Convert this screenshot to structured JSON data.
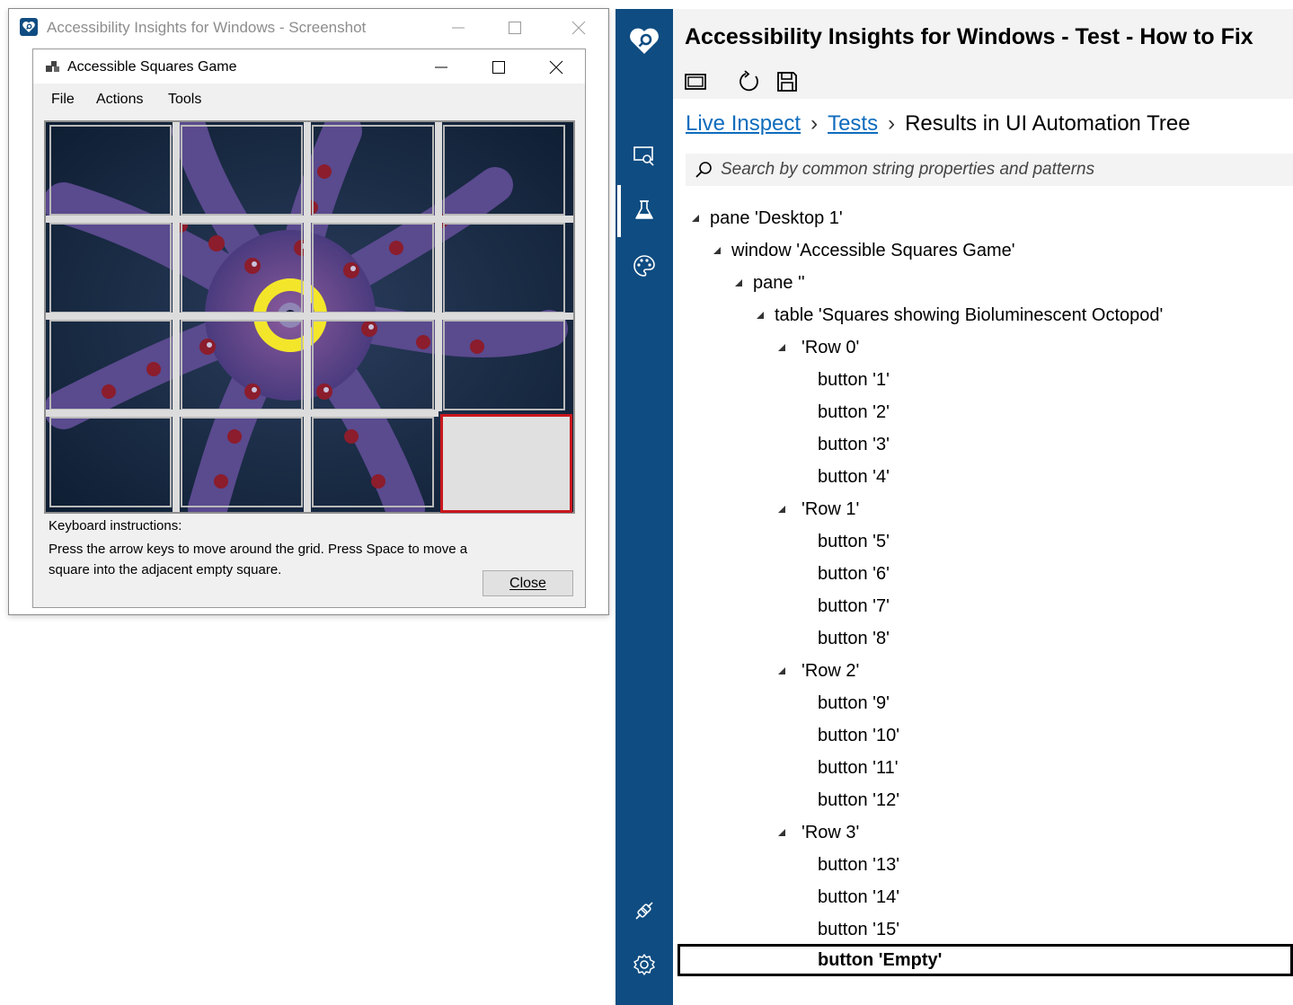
{
  "screenshot_window": {
    "title": "Accessibility Insights for Windows - Screenshot",
    "game": {
      "title": "Accessible Squares Game",
      "menu": [
        "File",
        "Actions",
        "Tools"
      ],
      "keyboard_heading": "Keyboard instructions:",
      "keyboard_text": "Press the arrow keys to move around the grid. Press Space to move a square into the adjacent empty square.",
      "close_label": "Close",
      "grid_rows": 4,
      "grid_cols": 4,
      "empty_tile": 16,
      "colors": {
        "empty_border": "#c8171d",
        "ring": "#f3e62a",
        "octopus": "#4a3b7e",
        "water": "#14283f"
      }
    }
  },
  "app": {
    "heading": "Accessibility Insights for Windows - Test - How to Fix",
    "toolbar": [
      "window-icon",
      "refresh-icon",
      "save-icon"
    ],
    "rail_icons": [
      "inspect-icon",
      "test-flask-icon",
      "color-palette-icon",
      "connection-icon",
      "settings-icon"
    ],
    "colors": {
      "rail": "#0f4c81",
      "link": "#0f6cbd"
    }
  },
  "breadcrumb": {
    "link1": "Live Inspect",
    "link2": "Tests",
    "current": "Results in UI Automation Tree"
  },
  "search": {
    "placeholder": "Search by common string properties and patterns"
  },
  "tree": [
    {
      "label": "pane 'Desktop 1'",
      "level": 0,
      "expanded": true
    },
    {
      "label": "window 'Accessible Squares Game'",
      "level": 1,
      "expanded": true
    },
    {
      "label": "pane ''",
      "level": 2,
      "expanded": true
    },
    {
      "label": "table 'Squares showing Bioluminescent Octopod'",
      "level": 3,
      "expanded": true
    },
    {
      "label": "'Row 0'",
      "level": 4,
      "expanded": true
    },
    {
      "label": "button '1'",
      "level": 5
    },
    {
      "label": "button '2'",
      "level": 5
    },
    {
      "label": "button '3'",
      "level": 5
    },
    {
      "label": "button '4'",
      "level": 5
    },
    {
      "label": "'Row 1'",
      "level": 4,
      "expanded": true
    },
    {
      "label": "button '5'",
      "level": 5
    },
    {
      "label": "button '6'",
      "level": 5
    },
    {
      "label": "button '7'",
      "level": 5
    },
    {
      "label": "button '8'",
      "level": 5
    },
    {
      "label": "'Row 2'",
      "level": 4,
      "expanded": true
    },
    {
      "label": "button '9'",
      "level": 5
    },
    {
      "label": "button '10'",
      "level": 5
    },
    {
      "label": "button '11'",
      "level": 5
    },
    {
      "label": "button '12'",
      "level": 5
    },
    {
      "label": "'Row 3'",
      "level": 4,
      "expanded": true
    },
    {
      "label": "button '13'",
      "level": 5
    },
    {
      "label": "button '14'",
      "level": 5
    },
    {
      "label": "button '15'",
      "level": 5
    },
    {
      "label": "button 'Empty'",
      "level": 5,
      "selected": true
    }
  ]
}
